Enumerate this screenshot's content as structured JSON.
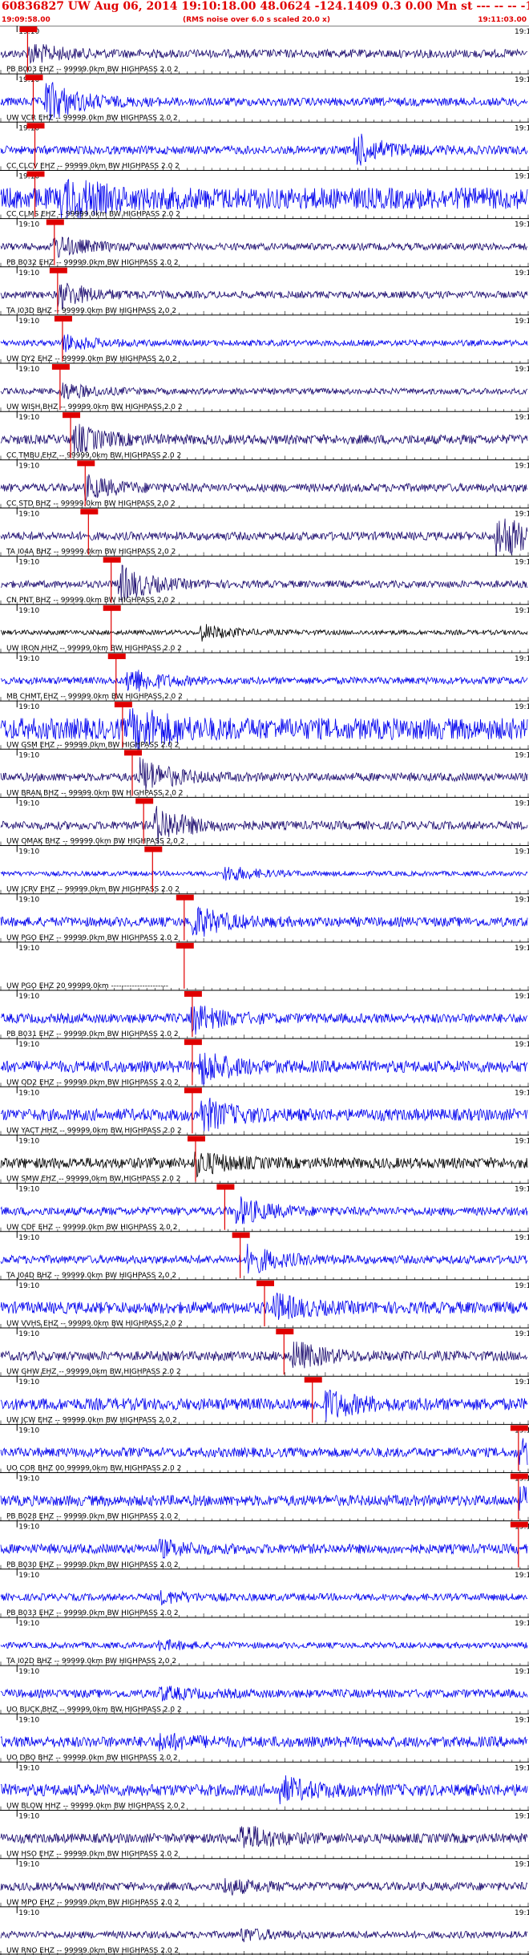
{
  "header": {
    "title": "60836827 UW Aug 06, 2014 19:10:18.00   48.0624 -124.1409  0.3 0.00 Mn st --- -- --  -1",
    "start_time": "19:09:58.00",
    "end_time": "19:11:03.00",
    "rms_note": "(RMS noise over 6.0 s scaled 20.0 x)"
  },
  "chart_data": {
    "type": "line",
    "title": "60836827 UW Aug 06, 2014 19:10:18.00   48.0624 -124.1409  0.3 0.00 Mn st --- -- --  -1",
    "x_range": [
      "19:09:58.00",
      "19:11:03.00"
    ],
    "minute_mark_left": "19:10",
    "minute_mark_right": "19:1",
    "colors": {
      "blue": "#0000ee",
      "navy": "#1a0a6e",
      "black": "#000000",
      "pick": "#e00000"
    },
    "traces": [
      {
        "label": "PB B003 EHZ -- 99999.0km BW  HIGHPASS  2.0  2",
        "color": "navy",
        "pick_time": 3.3,
        "amp": 0.35,
        "burst_at": 4.0,
        "burst_amp": 0.7
      },
      {
        "label": "UW VCR EHZ -- 99999.0km BW  HIGHPASS  2.0  2",
        "color": "blue",
        "pick_time": 4.0,
        "amp": 0.35,
        "burst_at": 6.0,
        "burst_amp": 1.6
      },
      {
        "label": "CC CLCV EHZ -- 99999.0km BW  HIGHPASS  2.0  2",
        "color": "blue",
        "pick_time": 4.2,
        "amp": 0.35,
        "burst_at": 44.0,
        "burst_amp": 1.2
      },
      {
        "label": "CC CLMS EHZ -- 99999.0km BW  HIGHPASS  2.0  2",
        "color": "blue",
        "pick_time": 4.2,
        "amp": 0.9,
        "burst_at": 8.0,
        "burst_amp": 1.6
      },
      {
        "label": "PB B032 EHZ -- 99999.0km BW  HIGHPASS  2.0  2",
        "color": "navy",
        "pick_time": 6.6,
        "amp": 0.3,
        "burst_at": 7.0,
        "burst_amp": 0.8
      },
      {
        "label": "TA I03D BHZ -- 99999.0km BW  HIGHPASS  2.0  2",
        "color": "navy",
        "pick_time": 7.0,
        "amp": 0.3,
        "burst_at": 7.5,
        "burst_amp": 1.0
      },
      {
        "label": "UW DY2 EHZ -- 99999.0km BW  HIGHPASS  2.0  2",
        "color": "blue",
        "pick_time": 7.6,
        "amp": 0.25,
        "burst_at": 8.0,
        "burst_amp": 0.6
      },
      {
        "label": "UW WISH BHZ -- 99999.0km BW  HIGHPASS  2.0  2",
        "color": "navy",
        "pick_time": 7.3,
        "amp": 0.25,
        "burst_at": 8.0,
        "burst_amp": 0.6
      },
      {
        "label": "CC TMBU EHZ -- 99999.0km BW  HIGHPASS  2.0  2",
        "color": "navy",
        "pick_time": 8.6,
        "amp": 0.4,
        "burst_at": 9.5,
        "burst_amp": 1.0
      },
      {
        "label": "CC STD BHZ -- 99999.0km BW  HIGHPASS  2.0  2",
        "color": "navy",
        "pick_time": 10.4,
        "amp": 0.35,
        "burst_at": 11.0,
        "burst_amp": 0.8
      },
      {
        "label": "TA I04A BHZ -- 99999.0km BW  HIGHPASS  2.0  2",
        "color": "navy",
        "pick_time": 10.8,
        "amp": 0.35,
        "burst_at": 61.5,
        "burst_amp": 2.0
      },
      {
        "label": "CN PNT BHZ -- 99999.0km BW  HIGHPASS  2.0  2",
        "color": "navy",
        "pick_time": 13.6,
        "amp": 0.3,
        "burst_at": 15.0,
        "burst_amp": 1.4
      },
      {
        "label": "UW IRON HHZ -- 99999.0km BW  HIGHPASS  2.0  2",
        "color": "black",
        "pick_time": 13.6,
        "amp": 0.2,
        "burst_at": 25.0,
        "burst_amp": 0.6
      },
      {
        "label": "MB CHMT EHZ -- 99999.0km BW  HIGHPASS  2.0  2",
        "color": "blue",
        "pick_time": 14.2,
        "amp": 0.3,
        "burst_at": 16.0,
        "burst_amp": 1.0
      },
      {
        "label": "UW GSM EHZ -- 99999.0km BW  HIGHPASS  2.0  2",
        "color": "blue",
        "pick_time": 15.0,
        "amp": 0.9,
        "burst_at": 16.5,
        "burst_amp": 1.6
      },
      {
        "label": "UW BRAN BHZ -- 99999.0km BW  HIGHPASS  2.0  2",
        "color": "navy",
        "pick_time": 16.2,
        "amp": 0.35,
        "burst_at": 17.5,
        "burst_amp": 1.4
      },
      {
        "label": "UW OMAK BHZ -- 99999.0km BW  HIGHPASS  2.0  2",
        "color": "navy",
        "pick_time": 17.6,
        "amp": 0.35,
        "burst_at": 19.5,
        "burst_amp": 1.4
      },
      {
        "label": "UW JCRV EHZ -- 99999.0km BW  HIGHPASS  2.0  2",
        "color": "blue",
        "pick_time": 18.7,
        "amp": 0.2,
        "burst_at": 28.0,
        "burst_amp": 0.6
      },
      {
        "label": "UW PGO EHZ -- 99999.0km BW  HIGHPASS  2.0  2",
        "color": "blue",
        "pick_time": 22.6,
        "amp": 0.4,
        "burst_at": 24.0,
        "burst_amp": 1.2
      },
      {
        "label": "UW PGO EHZ 20 99999.0km ----------------------",
        "color": "blue",
        "pick_time": 22.6,
        "amp": 0.0,
        "burst_at": 24.0,
        "burst_amp": 0.0
      },
      {
        "label": "PB B031 EHZ -- 99999.0km BW  HIGHPASS  2.0  2",
        "color": "blue",
        "pick_time": 23.6,
        "amp": 0.4,
        "burst_at": 24.0,
        "burst_amp": 1.0
      },
      {
        "label": "UW OD2 EHZ -- 99999.0km BW  HIGHPASS  2.0  2",
        "color": "blue",
        "pick_time": 23.6,
        "amp": 0.5,
        "burst_at": 25.0,
        "burst_amp": 1.2
      },
      {
        "label": "UW YACT HHZ -- 99999.0km BW  HIGHPASS  2.0  2",
        "color": "blue",
        "pick_time": 23.6,
        "amp": 0.5,
        "burst_at": 25.0,
        "burst_amp": 1.2
      },
      {
        "label": "UW SMW EHZ -- 99999.0km BW  HIGHPASS  2.0  2",
        "color": "black",
        "pick_time": 24.0,
        "amp": 0.45,
        "burst_at": 24.5,
        "burst_amp": 0.8
      },
      {
        "label": "UW CDF EHZ -- 99999.0km BW  HIGHPASS  2.0  2",
        "color": "blue",
        "pick_time": 27.6,
        "amp": 0.35,
        "burst_at": 29.5,
        "burst_amp": 1.0
      },
      {
        "label": "TA J04D BHZ -- 99999.0km BW  HIGHPASS  2.0  2",
        "color": "blue",
        "pick_time": 29.5,
        "amp": 0.35,
        "burst_at": 31.0,
        "burst_amp": 1.0
      },
      {
        "label": "UW VVHS EHZ -- 99999.0km BW  HIGHPASS  2.0  2",
        "color": "blue",
        "pick_time": 32.5,
        "amp": 0.5,
        "burst_at": 34.0,
        "burst_amp": 0.9
      },
      {
        "label": "UW GHW EHZ -- 99999.0km BW  HIGHPASS  2.0  2",
        "color": "navy",
        "pick_time": 34.9,
        "amp": 0.4,
        "burst_at": 36.5,
        "burst_amp": 1.0
      },
      {
        "label": "UW JCW EHZ -- 99999.0km BW  HIGHPASS  2.0  2",
        "color": "blue",
        "pick_time": 38.4,
        "amp": 0.5,
        "burst_at": 40.5,
        "burst_amp": 1.0
      },
      {
        "label": "UO COR BHZ 00 99999.0km BW  HIGHPASS  2.0  2",
        "color": "blue",
        "pick_time": 63.8,
        "amp": 0.4,
        "burst_at": 64.5,
        "burst_amp": 0.8
      },
      {
        "label": "PB B028 EHZ -- 99999.0km BW  HIGHPASS  2.0  2",
        "color": "blue",
        "pick_time": 63.8,
        "amp": 0.45,
        "burst_at": 64.5,
        "burst_amp": 0.8
      },
      {
        "label": "PB B030 EHZ -- 99999.0km BW  HIGHPASS  2.0  2",
        "color": "blue",
        "pick_time": 63.8,
        "amp": 0.4,
        "burst_at": 20.0,
        "burst_amp": 0.5
      },
      {
        "label": "PB B033 EHZ -- 99999.0km BW  HIGHPASS  2.0  2",
        "color": "blue",
        "pick_time": null,
        "amp": 0.3,
        "burst_at": 20.0,
        "burst_amp": 0.4
      },
      {
        "label": "TA I02D BHZ -- 99999.0km BW  HIGHPASS  2.0  2",
        "color": "blue",
        "pick_time": null,
        "amp": 0.25,
        "burst_at": 20.0,
        "burst_amp": 0.3
      },
      {
        "label": "UO BUCK BHZ -- 99999.0km BW  HIGHPASS  2.0  2",
        "color": "blue",
        "pick_time": null,
        "amp": 0.35,
        "burst_at": 20.0,
        "burst_amp": 0.4
      },
      {
        "label": "UO DBO BHZ -- 99999.0km BW  HIGHPASS  2.0  2",
        "color": "blue",
        "pick_time": null,
        "amp": 0.45,
        "burst_at": 20.0,
        "burst_amp": 0.5
      },
      {
        "label": "UW BLOW HHZ -- 99999.0km BW  HIGHPASS  2.0  2",
        "color": "blue",
        "pick_time": null,
        "amp": 0.5,
        "burst_at": 35.0,
        "burst_amp": 0.8
      },
      {
        "label": "UW HSO EHZ -- 99999.0km BW  HIGHPASS  2.0  2",
        "color": "navy",
        "pick_time": null,
        "amp": 0.4,
        "burst_at": 30.0,
        "burst_amp": 1.0
      },
      {
        "label": "UW MPO EHZ -- 99999.0km BW  HIGHPASS  2.0  2",
        "color": "navy",
        "pick_time": null,
        "amp": 0.35,
        "burst_at": 28.0,
        "burst_amp": 0.5
      },
      {
        "label": "UW RNO EHZ -- 99999.0km BW  HIGHPASS  2.0  2",
        "color": "navy",
        "pick_time": null,
        "amp": 0.3,
        "burst_at": 30.0,
        "burst_amp": 0.4
      }
    ]
  }
}
